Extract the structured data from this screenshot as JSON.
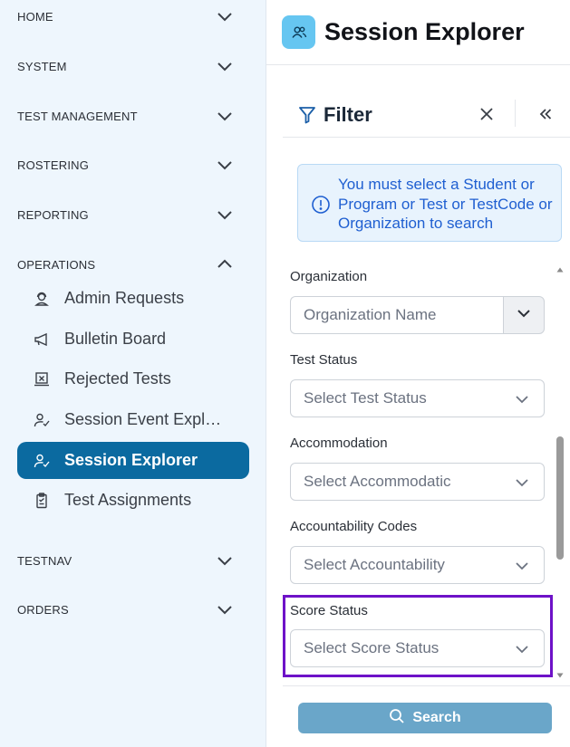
{
  "sidebar": {
    "sections": [
      {
        "label": "HOME",
        "state": "collapsed"
      },
      {
        "label": "SYSTEM",
        "state": "collapsed"
      },
      {
        "label": "TEST MANAGEMENT",
        "state": "collapsed"
      },
      {
        "label": "ROSTERING",
        "state": "collapsed"
      },
      {
        "label": "REPORTING",
        "state": "collapsed"
      },
      {
        "label": "OPERATIONS",
        "state": "expanded"
      },
      {
        "label": "TESTNAV",
        "state": "collapsed"
      },
      {
        "label": "ORDERS",
        "state": "collapsed"
      }
    ],
    "operations_items": [
      {
        "label": "Admin Requests",
        "icon": "user-headset-icon"
      },
      {
        "label": "Bulletin Board",
        "icon": "megaphone-icon"
      },
      {
        "label": "Rejected Tests",
        "icon": "rejected-tests-icon"
      },
      {
        "label": "Session Event Expl…",
        "icon": "user-check-icon"
      },
      {
        "label": "Session Explorer",
        "icon": "user-check-icon",
        "active": true
      },
      {
        "label": "Test Assignments",
        "icon": "clipboard-icon"
      }
    ]
  },
  "header": {
    "title": "Session Explorer",
    "icon": "users-icon",
    "icon_color": "#66c6f1"
  },
  "filter": {
    "title": "Filter",
    "notice": "You must select a Student or Program or Test or TestCode or Organization to search",
    "fields": {
      "organization": {
        "label": "Organization",
        "placeholder": "Organization Name"
      },
      "test_status": {
        "label": "Test Status",
        "placeholder": "Select Test Status"
      },
      "accommodation": {
        "label": "Accommodation",
        "placeholder": "Select Accommodatic"
      },
      "accountability": {
        "label": "Accountability Codes",
        "placeholder": "Select Accountability"
      },
      "score_status": {
        "label": "Score Status",
        "placeholder": "Select Score Status"
      }
    },
    "search_label": "Search"
  },
  "colors": {
    "sidebar_bg": "#eef6fd",
    "active_item": "#0b6aa0",
    "notice_text": "#1f5fd1",
    "highlight": "#6e12c8",
    "search_button": "#6aa6c9"
  }
}
